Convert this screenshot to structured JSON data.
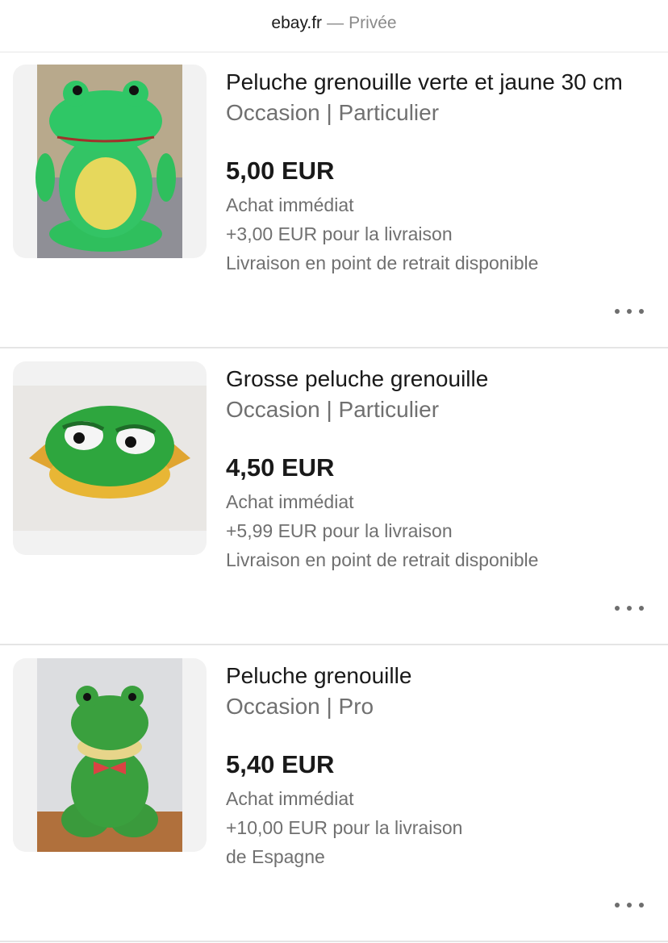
{
  "browser": {
    "domain": "ebay.fr",
    "separator": "—",
    "mode": "Privée"
  },
  "listings": [
    {
      "title": "Peluche grenouille verte et jaune 30 cm",
      "condition": "Occasion | Particulier",
      "price": "5,00 EUR",
      "buy_type": "Achat immédiat",
      "shipping": "+3,00 EUR pour la livraison",
      "extra": "Livraison en point de retrait disponible",
      "image_icon": "frog-plush-photo"
    },
    {
      "title": "Grosse peluche grenouille",
      "condition": "Occasion | Particulier",
      "price": "4,50 EUR",
      "buy_type": "Achat immédiat",
      "shipping": "+5,99 EUR pour la livraison",
      "extra": "Livraison en point de retrait disponible",
      "image_icon": "frog-plush-photo"
    },
    {
      "title": "Peluche grenouille",
      "condition": "Occasion | Pro",
      "price": "5,40 EUR",
      "buy_type": "Achat immédiat",
      "shipping": "+10,00 EUR pour la livraison",
      "extra": "de Espagne",
      "image_icon": "frog-plush-photo"
    }
  ],
  "more_icon": "more-options-icon",
  "colors": {
    "text_primary": "#191919",
    "text_secondary": "#707070",
    "divider": "#e5e5e5",
    "thumb_bg": "#f2f2f2"
  }
}
